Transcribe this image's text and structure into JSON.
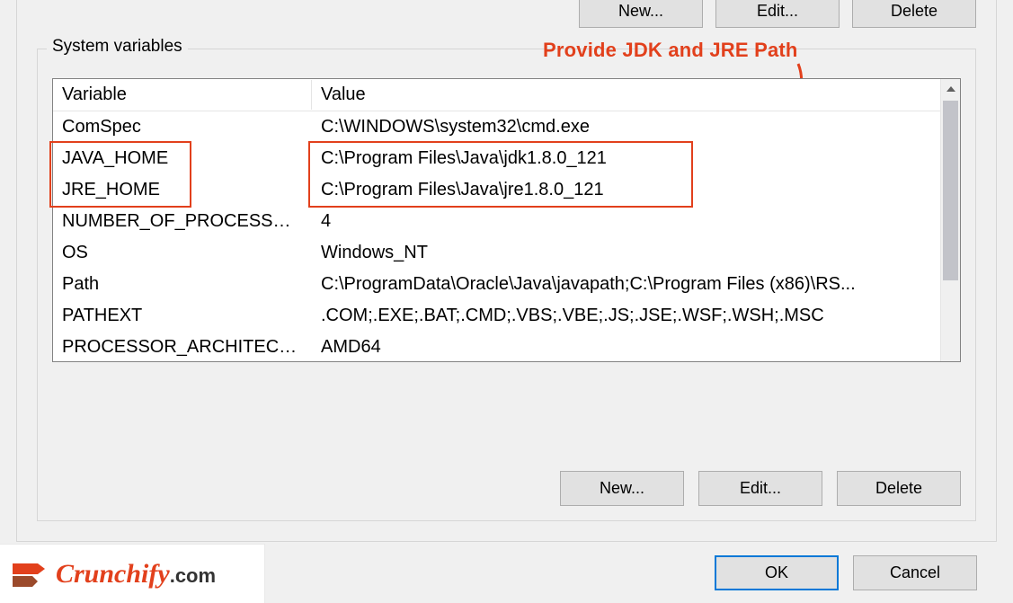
{
  "section": {
    "label": "System variables"
  },
  "annotation": {
    "text": "Provide JDK and JRE Path"
  },
  "table": {
    "header_variable": "Variable",
    "header_value": "Value",
    "rows": [
      {
        "variable": "ComSpec",
        "value": "C:\\WINDOWS\\system32\\cmd.exe"
      },
      {
        "variable": "JAVA_HOME",
        "value": "C:\\Program Files\\Java\\jdk1.8.0_121"
      },
      {
        "variable": "JRE_HOME",
        "value": "C:\\Program Files\\Java\\jre1.8.0_121"
      },
      {
        "variable": "NUMBER_OF_PROCESSORS",
        "value": "4"
      },
      {
        "variable": "OS",
        "value": "Windows_NT"
      },
      {
        "variable": "Path",
        "value": "C:\\ProgramData\\Oracle\\Java\\javapath;C:\\Program Files (x86)\\RS..."
      },
      {
        "variable": "PATHEXT",
        "value": ".COM;.EXE;.BAT;.CMD;.VBS;.VBE;.JS;.JSE;.WSF;.WSH;.MSC"
      },
      {
        "variable": "PROCESSOR_ARCHITECTURE",
        "value": "AMD64"
      }
    ]
  },
  "buttons": {
    "new": "New...",
    "edit": "Edit...",
    "delete": "Delete",
    "ok": "OK",
    "cancel": "Cancel"
  },
  "branding": {
    "name": "Crunchify",
    "suffix": ".com"
  }
}
